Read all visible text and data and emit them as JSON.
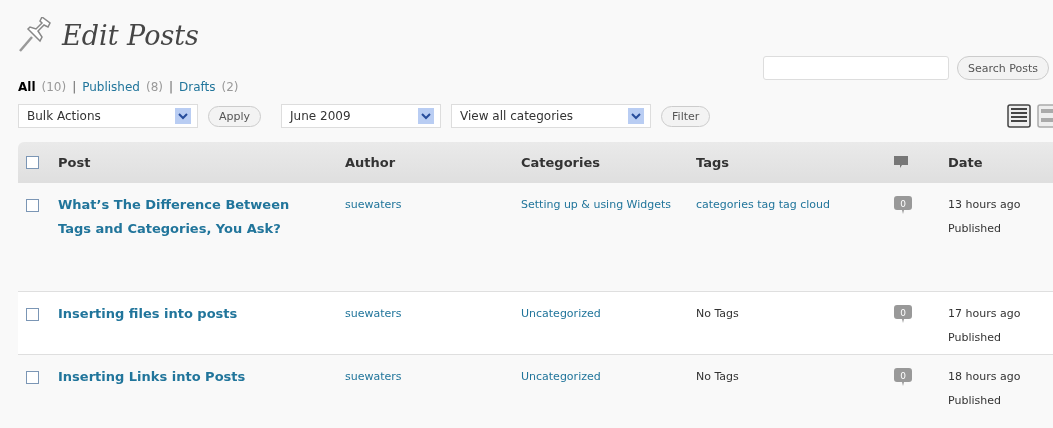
{
  "header": {
    "title": "Edit Posts"
  },
  "status_filters": [
    {
      "label": "All",
      "count": "(10)",
      "selected": true
    },
    {
      "label": "Published",
      "count": "(8)",
      "selected": false
    },
    {
      "label": "Drafts",
      "count": "(2)",
      "selected": false
    }
  ],
  "separator": "|",
  "search": {
    "button": "Search Posts"
  },
  "toolbar": {
    "bulk_actions": "Bulk Actions",
    "apply": "Apply",
    "month": "June 2009",
    "categories": "View all categories",
    "filter": "Filter"
  },
  "view_modes": [
    {
      "kind": "list",
      "selected": true
    },
    {
      "kind": "excerpt",
      "selected": false
    }
  ],
  "table": {
    "select_all_checked": false,
    "columns": [
      "Post",
      "Author",
      "Categories",
      "Tags",
      "Date"
    ],
    "rows": [
      {
        "checked": false,
        "title": "What’s The Difference Between Tags and Categories, You Ask?",
        "author": "suewaters",
        "categories": "Setting up & using Widgets",
        "tags": "categories tag tag cloud",
        "tags_linked": true,
        "comments": "0",
        "date": "13 hours ago",
        "status": "Published"
      },
      {
        "checked": false,
        "title": "Inserting files into posts",
        "author": "suewaters",
        "categories": "Uncategorized",
        "tags": "No Tags",
        "tags_linked": false,
        "comments": "0",
        "date": "17 hours ago",
        "status": "Published"
      },
      {
        "checked": false,
        "title": "Inserting Links into Posts",
        "author": "suewaters",
        "categories": "Uncategorized",
        "tags": "No Tags",
        "tags_linked": false,
        "comments": "0",
        "date": "18 hours ago",
        "status": "Published"
      }
    ]
  }
}
